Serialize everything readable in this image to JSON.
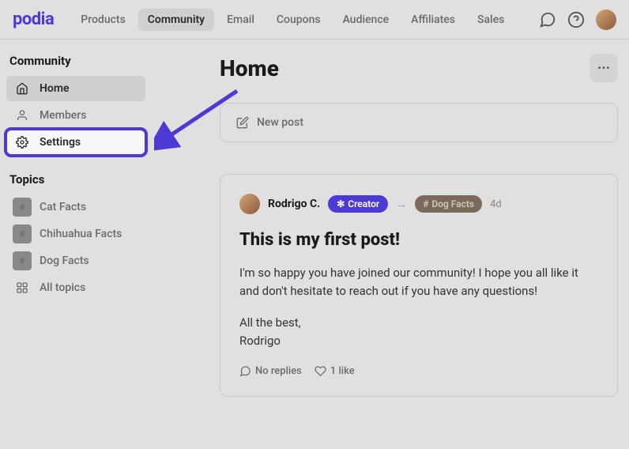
{
  "brand": "podia",
  "nav": {
    "items": [
      {
        "label": "Products",
        "active": false
      },
      {
        "label": "Community",
        "active": true
      },
      {
        "label": "Email",
        "active": false
      },
      {
        "label": "Coupons",
        "active": false
      },
      {
        "label": "Audience",
        "active": false
      },
      {
        "label": "Affiliates",
        "active": false
      },
      {
        "label": "Sales",
        "active": false
      }
    ]
  },
  "sidebar": {
    "heading": "Community",
    "items": [
      {
        "label": "Home",
        "state": "active"
      },
      {
        "label": "Members",
        "state": "normal"
      },
      {
        "label": "Settings",
        "state": "highlighted"
      }
    ],
    "topics_heading": "Topics",
    "topics": [
      {
        "label": "Cat Facts"
      },
      {
        "label": "Chihuahua Facts"
      },
      {
        "label": "Dog Facts"
      }
    ],
    "all_topics_label": "All topics"
  },
  "page": {
    "title": "Home",
    "new_post_label": "New post"
  },
  "post": {
    "author": "Rodrigo C.",
    "creator_badge": "Creator",
    "tag": "Dog Facts",
    "time": "4d",
    "title": "This is my first post!",
    "body": "I'm so happy you have joined our community! I hope you all like it and don't hesitate to reach out if you have any questions!",
    "sign1": "All the best,",
    "sign2": "Rodrigo",
    "replies_label": "No replies",
    "likes_label": "1 like"
  }
}
